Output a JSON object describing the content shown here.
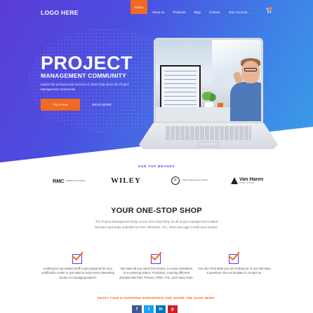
{
  "header": {
    "logo": "LOGO HERE",
    "nav": [
      {
        "label": "Home",
        "active": true
      },
      {
        "label": "About us",
        "active": false
      },
      {
        "label": "Products",
        "active": false
      },
      {
        "label": "Blog",
        "active": false
      },
      {
        "label": "Contact",
        "active": false
      },
      {
        "label": "Your Account",
        "active": false
      }
    ],
    "account_chevron": "⌄",
    "cart_icon": "cart-icon",
    "cart_count": "0"
  },
  "hero": {
    "title": "PROJECT",
    "subtitle": "MANAGEMENT COMMUNITY",
    "description": "Market the products and services of others that serve the Project Management Community",
    "primary_button": "Try It Free",
    "secondary_button": "READ MORE"
  },
  "brands": {
    "label": "OUR TOP BRANDS",
    "rmc": {
      "name": "RMC",
      "tagline": "LEARNING SOLUTIONS"
    },
    "wiley": "WILEY",
    "pmi": {
      "mark": "P",
      "text": "Project Management Institute"
    },
    "vanharen": {
      "name": "Van Haren",
      "tagline": "PUBLISHING"
    }
  },
  "one_stop": {
    "title": "YOUR ONE-STOP SHOP",
    "description": "The Project Management Shop is your One-Stop-Shop for all project management related literature and study materials for PMI, PRINCE2, ITIL, IPMA and Agile Certification Exams.",
    "features": [
      {
        "icon": "checkbox-icon",
        "text": "Looking for top-ranked stuff to get prepared for your certification exam or just want to read some interesting books on managing teams?"
      },
      {
        "icon": "checkbox-icon",
        "text": "We have all you need from books, to exam simulators to e-Learning videos, Podcasts, covering different domains like PMI, Prince2, IPMA, ITIL, and many more."
      },
      {
        "icon": "checkbox-icon",
        "text": "You don't find what you are looking for or you still have a question? Do not hesitate to contact us."
      }
    ]
  },
  "share": {
    "label": "ENJOY YOUR E-SHOPPING EXPERIENCE AND SHARE THE GOOD NEWS.",
    "facebook": "f",
    "twitter": "t",
    "linkedin": "in",
    "pinterest": "p"
  },
  "colors": {
    "accent": "#f26a21",
    "primary": "#5a3bd6",
    "hero_end": "#3aa0e8"
  }
}
